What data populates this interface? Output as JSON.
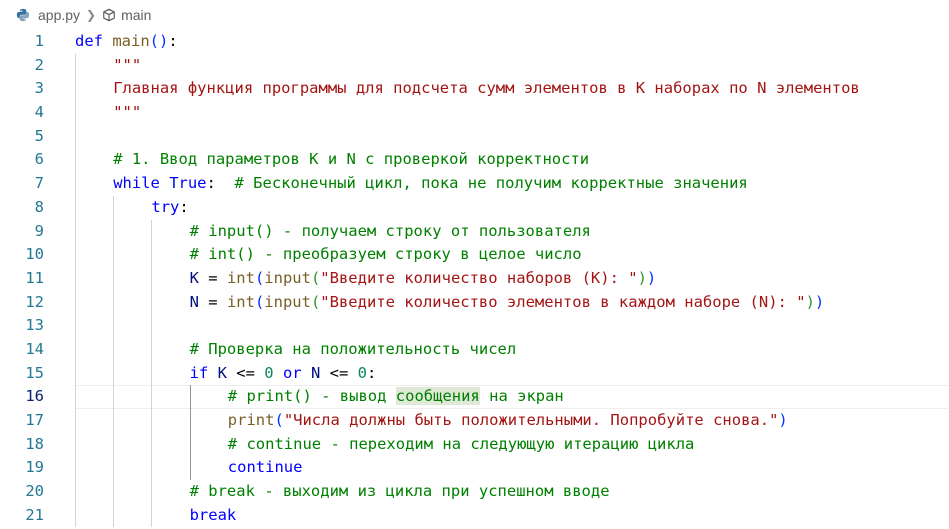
{
  "breadcrumb": {
    "file": "app.py",
    "symbol": "main"
  },
  "editor": {
    "current_line": 16,
    "lines": [
      {
        "n": "1",
        "tokens": [
          [
            "kw",
            "def "
          ],
          [
            "fn",
            "main"
          ],
          [
            "br1",
            "()"
          ],
          [
            "",
            ":"
          ]
        ]
      },
      {
        "n": "2",
        "tokens": [
          [
            "str",
            "\"\"\""
          ]
        ]
      },
      {
        "n": "3",
        "tokens": [
          [
            "str",
            "Главная функция программы для подсчета сумм элементов в K наборах по N элементов"
          ]
        ]
      },
      {
        "n": "4",
        "tokens": [
          [
            "str",
            "\"\"\""
          ]
        ]
      },
      {
        "n": "5",
        "tokens": []
      },
      {
        "n": "6",
        "tokens": [
          [
            "com",
            "# 1. Ввод параметров K и N с проверкой корректности"
          ]
        ]
      },
      {
        "n": "7",
        "tokens": [
          [
            "kw",
            "while "
          ],
          [
            "kw",
            "True"
          ],
          [
            "",
            ":  "
          ],
          [
            "com",
            "# Бесконечный цикл, пока не получим корректные значения"
          ]
        ]
      },
      {
        "n": "8",
        "tokens": [
          [
            "kw",
            "try"
          ],
          [
            "",
            ":"
          ]
        ]
      },
      {
        "n": "9",
        "tokens": [
          [
            "com",
            "# input() - получаем строку от пользователя"
          ]
        ]
      },
      {
        "n": "10",
        "tokens": [
          [
            "com",
            "# int() - преобразуем строку в целое число"
          ]
        ]
      },
      {
        "n": "11",
        "tokens": [
          [
            "var",
            "K"
          ],
          [
            "",
            " = "
          ],
          [
            "fn",
            "int"
          ],
          [
            "br1",
            "("
          ],
          [
            "fn",
            "input"
          ],
          [
            "br2",
            "("
          ],
          [
            "str",
            "\"Введите количество наборов (K): \""
          ],
          [
            "br2",
            ")"
          ],
          [
            "br1",
            ")"
          ]
        ]
      },
      {
        "n": "12",
        "tokens": [
          [
            "var",
            "N"
          ],
          [
            "",
            " = "
          ],
          [
            "fn",
            "int"
          ],
          [
            "br1",
            "("
          ],
          [
            "fn",
            "input"
          ],
          [
            "br2",
            "("
          ],
          [
            "str",
            "\"Введите количество элементов в каждом наборе (N): \""
          ],
          [
            "br2",
            ")"
          ],
          [
            "br1",
            ")"
          ]
        ]
      },
      {
        "n": "13",
        "tokens": []
      },
      {
        "n": "14",
        "tokens": [
          [
            "com",
            "# Проверка на положительность чисел"
          ]
        ]
      },
      {
        "n": "15",
        "tokens": [
          [
            "kw",
            "if "
          ],
          [
            "var",
            "K"
          ],
          [
            "",
            " <= "
          ],
          [
            "num",
            "0"
          ],
          [
            "kw",
            " or "
          ],
          [
            "var",
            "N"
          ],
          [
            "",
            " <= "
          ],
          [
            "num",
            "0"
          ],
          [
            "",
            ":"
          ]
        ]
      },
      {
        "n": "16",
        "tokens": [
          [
            "com",
            "# print() - вывод "
          ],
          [
            "com hl",
            "сообщения"
          ],
          [
            "com",
            " на экран"
          ]
        ]
      },
      {
        "n": "17",
        "tokens": [
          [
            "fn",
            "print"
          ],
          [
            "br1",
            "("
          ],
          [
            "str",
            "\"Числа должны быть положительными. Попробуйте снова.\""
          ],
          [
            "br1",
            ")"
          ]
        ]
      },
      {
        "n": "18",
        "tokens": [
          [
            "com",
            "# continue - переходим на следующую итерацию цикла"
          ]
        ]
      },
      {
        "n": "19",
        "tokens": [
          [
            "kw",
            "continue"
          ]
        ]
      },
      {
        "n": "20",
        "tokens": [
          [
            "com",
            "# break - выходим из цикла при успешном вводе"
          ]
        ]
      },
      {
        "n": "21",
        "tokens": [
          [
            "kw",
            "break"
          ]
        ]
      }
    ]
  }
}
